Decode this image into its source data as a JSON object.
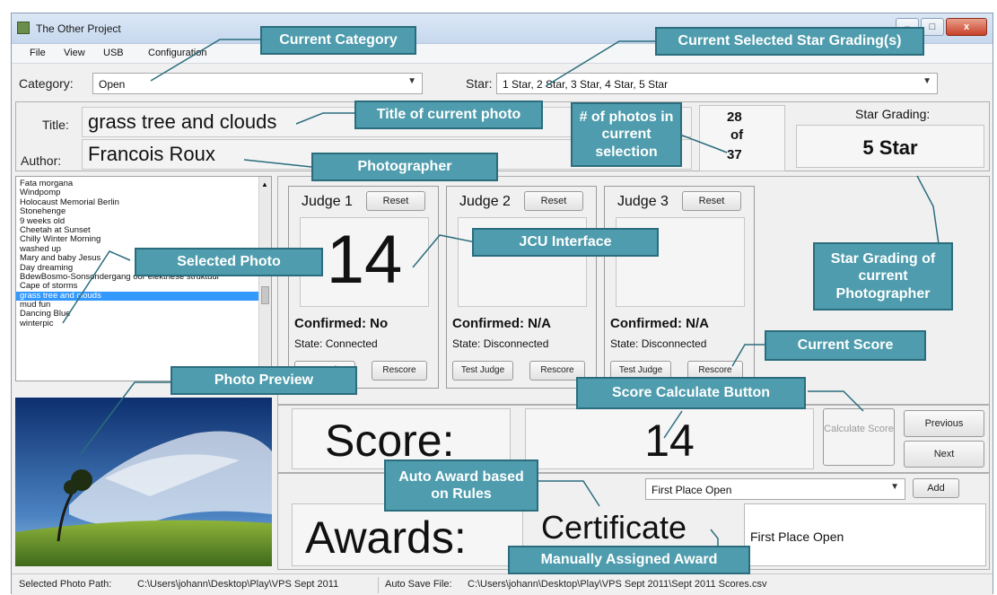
{
  "window": {
    "title": "The Other Project",
    "minimize": "–",
    "maximize": "□",
    "close": "x"
  },
  "menu": [
    "File",
    "View",
    "USB",
    "Configuration"
  ],
  "category": {
    "label": "Category:",
    "value": "Open"
  },
  "star": {
    "label": "Star:",
    "value": "1 Star, 2 Star, 3 Star, 4 Star, 5 Star"
  },
  "photo": {
    "title_label": "Title:",
    "title_value": "grass tree and clouds",
    "author_label": "Author:",
    "author_value": "Francois Roux",
    "counter": {
      "current": "28",
      "of": "of",
      "total": "37"
    }
  },
  "star_grading": {
    "label": "Star Grading:",
    "value": "5 Star"
  },
  "photo_list": {
    "items": [
      "Fata morgana",
      "Windpomp",
      "Holocaust Memorial Berlin",
      "Stonehenge",
      "9 weeks old",
      "Cheetah at Sunset",
      "Chilly Winter Morning",
      "washed up",
      "Mary and baby Jesus",
      "Day dreaming",
      "BdewBosmo-Sonsondergang oor elektriese struktuur",
      "Cape of storms",
      "grass tree and clouds",
      "mud fun",
      "Dancing Blue",
      "winterpic"
    ],
    "selected_index": 12
  },
  "judges": [
    {
      "name": "Judge 1",
      "reset": "Reset",
      "score": "14",
      "confirmed": "Confirmed: No",
      "state": "State:  Connected",
      "test": "Test Judge",
      "rescore": "Rescore"
    },
    {
      "name": "Judge 2",
      "reset": "Reset",
      "score": "",
      "confirmed": "Confirmed: N/A",
      "state": "State:  Disconnected",
      "test": "Test Judge",
      "rescore": "Rescore"
    },
    {
      "name": "Judge 3",
      "reset": "Reset",
      "score": "",
      "confirmed": "Confirmed: N/A",
      "state": "State:  Disconnected",
      "test": "Test Judge",
      "rescore": "Rescore"
    }
  ],
  "score": {
    "label": "Score:",
    "value": "14",
    "calculate": "Calculate Score",
    "previous": "Previous",
    "next": "Next"
  },
  "awards": {
    "label": "Awards:",
    "auto": "Certificate",
    "select_value": "First Place Open",
    "add": "Add",
    "assigned": "First Place Open"
  },
  "statusbar": {
    "path_label": "Selected Photo Path:",
    "path_value": "C:\\Users\\johann\\Desktop\\Play\\VPS Sept 2011",
    "save_label": "Auto Save File:",
    "save_value": "C:\\Users\\johann\\Desktop\\Play\\VPS Sept 2011\\Sept 2011 Scores.csv"
  },
  "callouts": {
    "current_category": "Current Category",
    "current_star": "Current Selected Star Grading(s)",
    "title_current": "Title of current photo",
    "num_photos": "# of photos in current selection",
    "photographer": "Photographer",
    "selected_photo": "Selected Photo",
    "jcu_interface": "JCU Interface",
    "star_grading_photographer": "Star Grading of current Photographer",
    "current_score": "Current Score",
    "photo_preview": "Photo Preview",
    "score_calc_button": "Score Calculate Button",
    "auto_award": "Auto Award based on Rules",
    "manual_award": "Manually Assigned Award"
  },
  "colors": {
    "callout_fill": "#4e9cad",
    "callout_border": "#2b6d7d",
    "selection": "#3399ff"
  }
}
